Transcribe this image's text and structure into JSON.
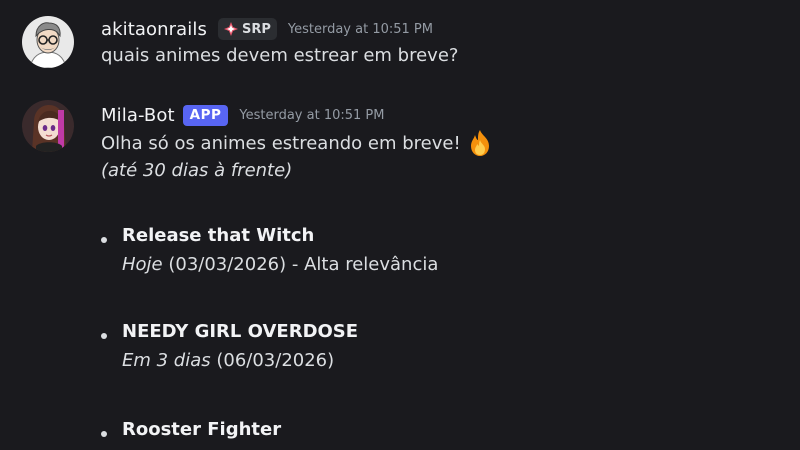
{
  "messages": {
    "user": {
      "username": "akitaonrails",
      "tag": "SRP",
      "timestamp": "Yesterday at 10:51 PM",
      "text": "quais animes devem estrear em breve?"
    },
    "bot": {
      "username": "Mila-Bot",
      "badge": "APP",
      "timestamp": "Yesterday at 10:51 PM",
      "line1": "Olha só os animes estreando em breve!",
      "line2": "(até 30 dias à frente)",
      "items": [
        {
          "title": "Release that Witch",
          "when": "Hoje",
          "rest": " (03/03/2026) - Alta relevância"
        },
        {
          "title": "NEEDY GIRL OVERDOSE",
          "when": "Em 3 dias",
          "rest": " (06/03/2026)"
        },
        {
          "title": "Rooster Fighter"
        }
      ]
    }
  },
  "colors": {
    "background": "#1a1a1e",
    "app_badge": "#5865f2",
    "text": "#dbdee1",
    "timestamp": "#949ba4"
  },
  "icons": {
    "user_tag_icon": "diamond-icon",
    "bot_emoji": "fire-icon"
  }
}
